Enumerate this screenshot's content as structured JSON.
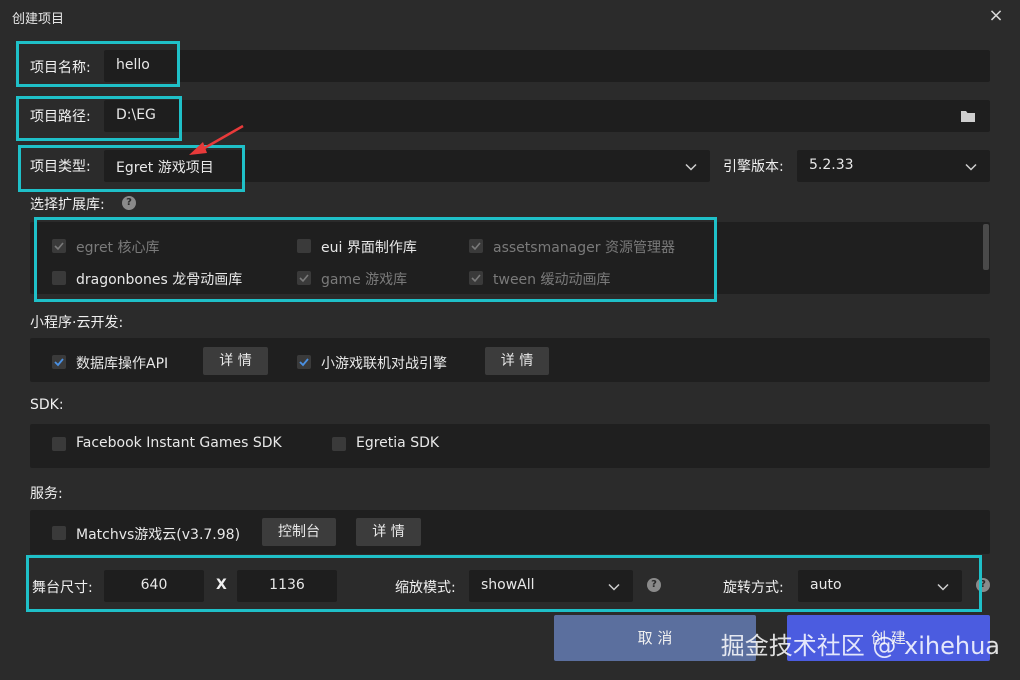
{
  "window": {
    "title": "创建项目",
    "close": "×"
  },
  "project": {
    "name_label": "项目名称:",
    "name_value": "hello",
    "path_label": "项目路径:",
    "path_value": "D:\\EG",
    "type_label": "项目类型:",
    "type_value": "Egret 游戏项目",
    "engine_label": "引擎版本:",
    "engine_value": "5.2.33"
  },
  "extensions": {
    "label": "选择扩展库:",
    "help": "?",
    "items": [
      {
        "label": "egret 核心库",
        "checked": true,
        "disabled": true
      },
      {
        "label": "eui 界面制作库",
        "checked": false,
        "disabled": false
      },
      {
        "label": "assetsmanager 资源管理器",
        "checked": true,
        "disabled": true
      },
      {
        "label": "dragonbones 龙骨动画库",
        "checked": false,
        "disabled": false
      },
      {
        "label": "game 游戏库",
        "checked": true,
        "disabled": true
      },
      {
        "label": "tween 缓动动画库",
        "checked": true,
        "disabled": true
      }
    ]
  },
  "cloud": {
    "label": "小程序·云开发:",
    "db_label": "数据库操作API",
    "db_detail": "详 情",
    "game_label": "小游戏联机对战引擎",
    "game_detail": "详 情"
  },
  "sdk": {
    "label": "SDK:",
    "fb_label": "Facebook Instant Games SDK",
    "egretia_label": "Egretia SDK"
  },
  "services": {
    "label": "服务:",
    "matchvs_label": "Matchvs游戏云(v3.7.98)",
    "console_label": "控制台",
    "detail_label": "详 情"
  },
  "stage": {
    "size_label": "舞台尺寸:",
    "width": "640",
    "x_label": "X",
    "height": "1136",
    "scale_label": "缩放模式:",
    "scale_value": "showAll",
    "rotate_label": "旋转方式:",
    "rotate_value": "auto",
    "help": "?"
  },
  "actions": {
    "cancel": "取 消",
    "create": "创 建"
  },
  "watermark": "掘金技术社区 @ xihehua",
  "colors": {
    "highlight": "#1fc0c8",
    "cancel_bg": "#5b6f9e",
    "create_bg": "#4b5ce0",
    "check": "#4a90e2"
  }
}
